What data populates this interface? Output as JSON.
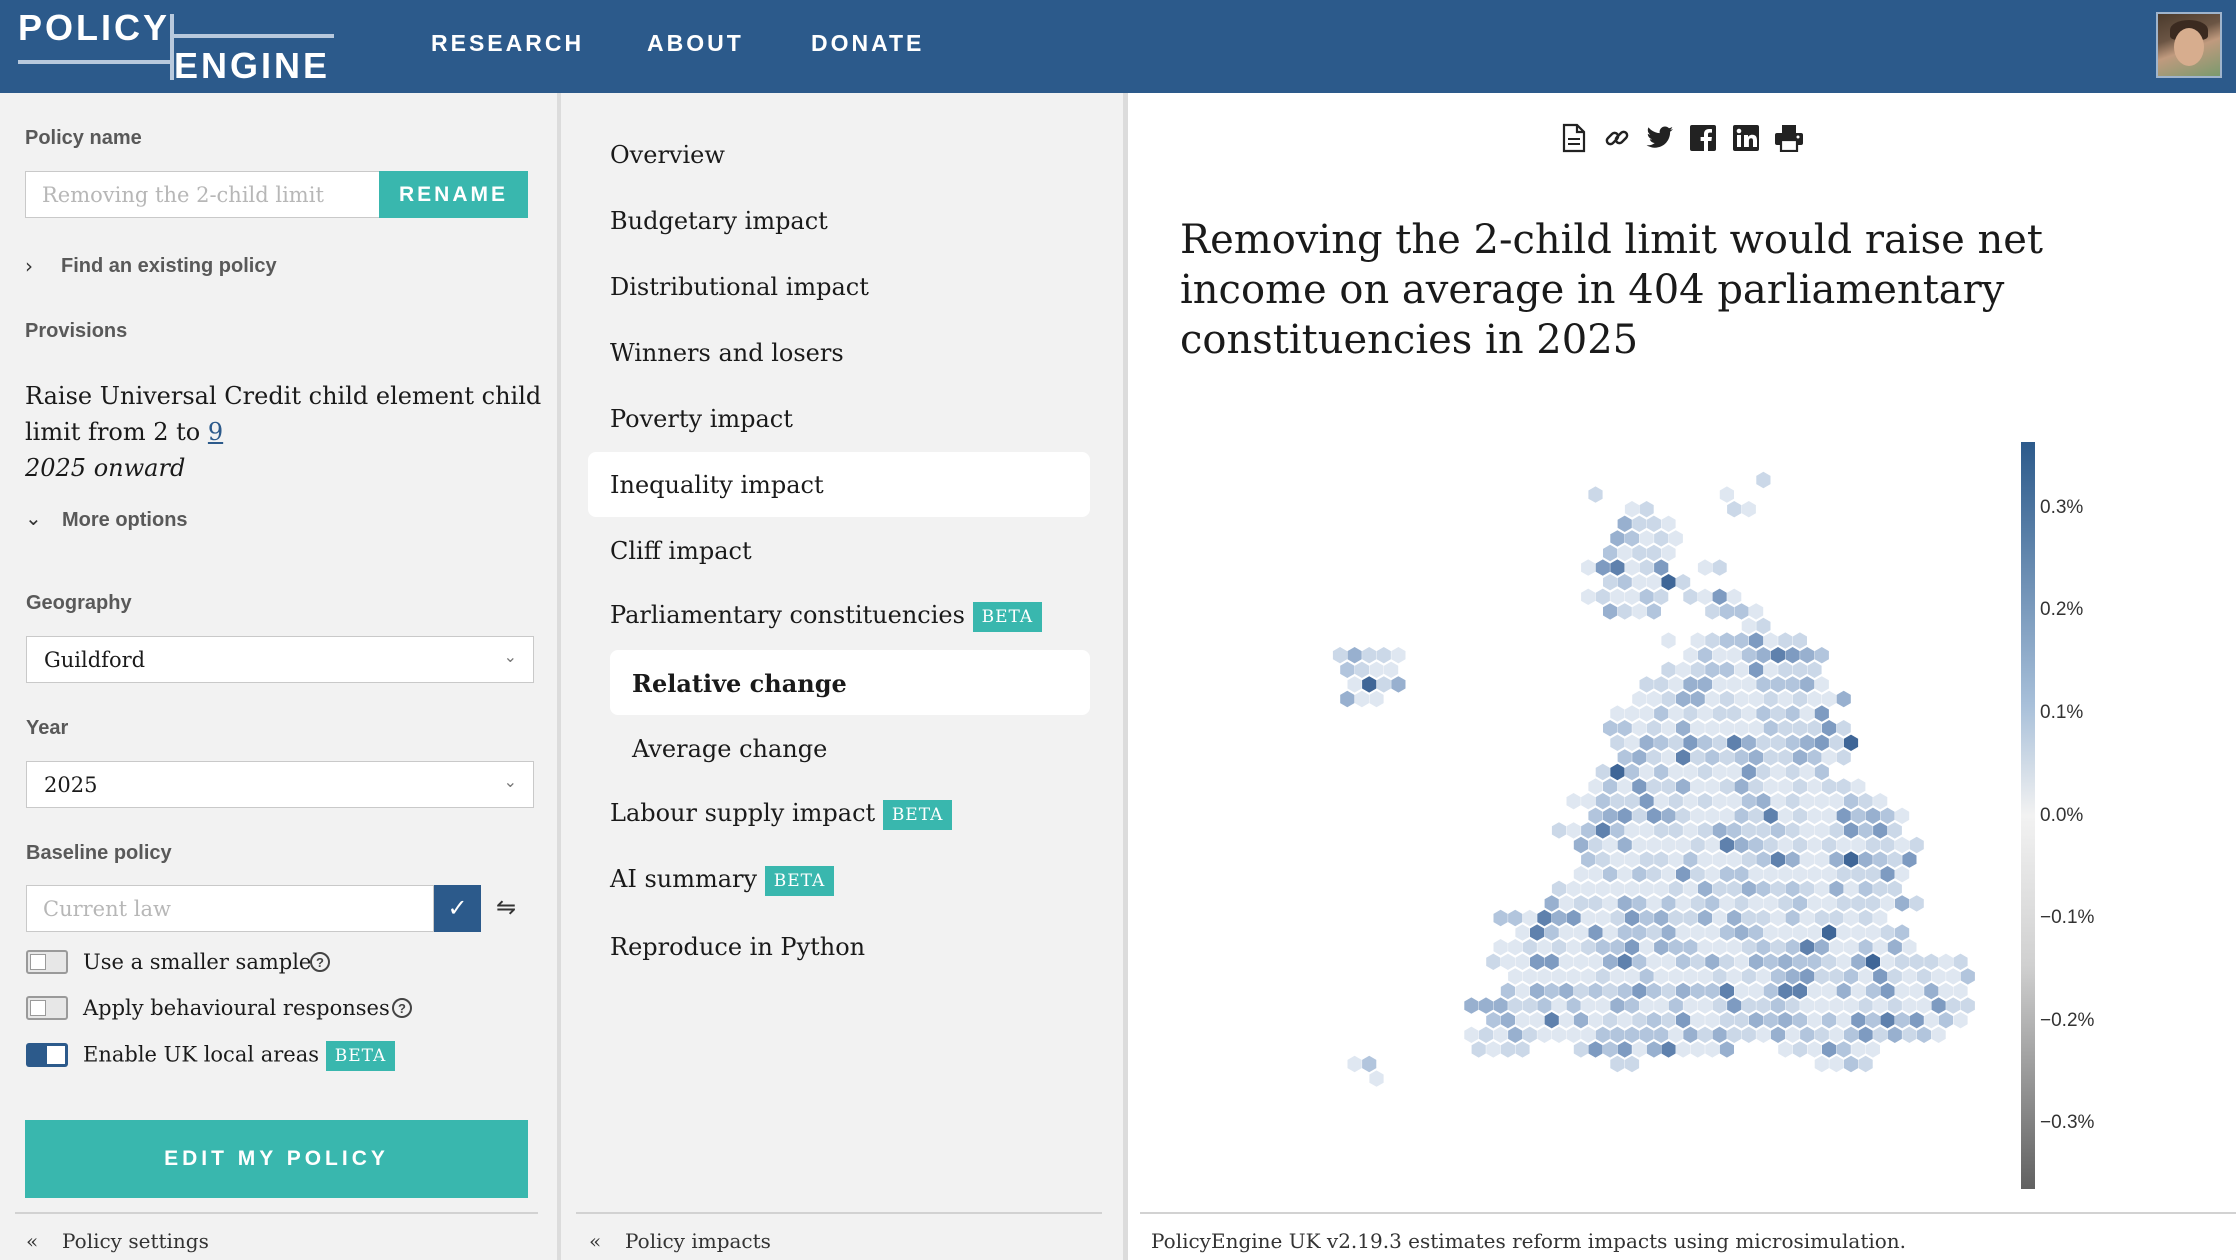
{
  "header": {
    "logo_line1": "POLICY",
    "logo_line2": "ENGINE",
    "nav": [
      "RESEARCH",
      "ABOUT",
      "DONATE"
    ]
  },
  "policy": {
    "name_label": "Policy name",
    "name_placeholder": "Removing the 2-child limit",
    "rename_label": "RENAME",
    "find_existing": "Find an existing policy",
    "provisions_label": "Provisions",
    "provision_text": "Raise Universal Credit child element child limit from 2 to",
    "provision_value": "9",
    "provision_period": "2025 onward",
    "more_options": "More options",
    "geography_label": "Geography",
    "geography_value": "Guildford",
    "year_label": "Year",
    "year_value": "2025",
    "baseline_label": "Baseline policy",
    "baseline_placeholder": "Current law",
    "toggles": [
      {
        "label": "Use a smaller sample",
        "on": false
      },
      {
        "label": "Apply behavioural responses",
        "on": false
      },
      {
        "label": "Enable UK local areas",
        "on": true
      }
    ],
    "beta": "BETA",
    "edit_button": "EDIT MY POLICY",
    "footer": "Policy settings"
  },
  "impacts": {
    "items": [
      "Overview",
      "Budgetary impact",
      "Distributional impact",
      "Winners and losers",
      "Poverty impact",
      "Inequality impact",
      "Cliff impact",
      "Parliamentary constituencies",
      "Relative change",
      "Average change",
      "Labour supply impact",
      "AI summary",
      "Reproduce in Python"
    ],
    "footer": "Policy impacts"
  },
  "result": {
    "icons": [
      "document-icon",
      "link-icon",
      "twitter-icon",
      "facebook-icon",
      "linkedin-icon",
      "print-icon"
    ],
    "title": "Removing the 2-child limit would raise net income on average in 404 parliamentary constituencies in 2025",
    "colorbar_ticks": [
      "0.3%",
      "0.2%",
      "0.1%",
      "0.0%",
      "−0.1%",
      "−0.2%",
      "−0.3%"
    ],
    "footer": "PolicyEngine UK v2.19.3 estimates reform impacts using microsimulation."
  },
  "colors": {
    "header": "#2c5a8b",
    "teal": "#39b7ae",
    "panel": "#f2f2f2"
  }
}
